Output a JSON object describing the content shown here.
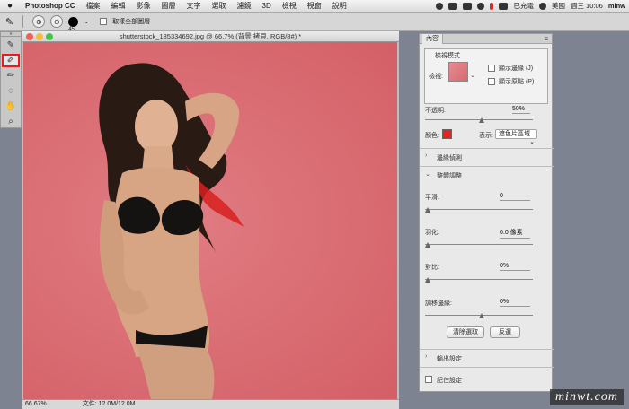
{
  "menubar": {
    "app": "Photoshop CC",
    "items": [
      "檔案",
      "編輯",
      "影像",
      "圖層",
      "文字",
      "選取",
      "濾鏡",
      "3D",
      "檢視",
      "視窗",
      "說明"
    ],
    "input_method": "已充電",
    "locale": "美國",
    "clock": "週三 10:06",
    "user": "minw"
  },
  "options_bar": {
    "brush_size": "45",
    "sample_all_layers_label": "取樣全部圖層"
  },
  "document": {
    "title": "shutterstock_185334692.jpg @ 66.7% (背景 拷貝, RGB/8#) *",
    "zoom": "66.67%",
    "file_info": "文件: 12.0M/12.0M"
  },
  "panel": {
    "tab_label": "內容",
    "view_mode_section": "檢視模式",
    "view_label": "檢視:",
    "show_edge_label": "顯示邊緣 (J)",
    "show_original_label": "顯示原點 (P)",
    "opacity_label": "不透明:",
    "opacity_value": "50%",
    "color_label": "顏色:",
    "color_value": "#e8231c",
    "display_label": "表示:",
    "display_value": "遮色片區域",
    "edge_detection_label": "邊緣偵測",
    "global_refine_label": "整體調整",
    "smooth_label": "平滑:",
    "smooth_value": "0",
    "feather_label": "羽化:",
    "feather_value": "0.0 像素",
    "contrast_label": "對比:",
    "contrast_value": "0%",
    "shift_edge_label": "調移邊緣:",
    "shift_edge_value": "0%",
    "clear_selection_button": "清除選取",
    "invert_button": "反選",
    "output_settings_label": "輸出設定",
    "remember_settings_label": "記住設定"
  },
  "watermark": "minwt.com"
}
